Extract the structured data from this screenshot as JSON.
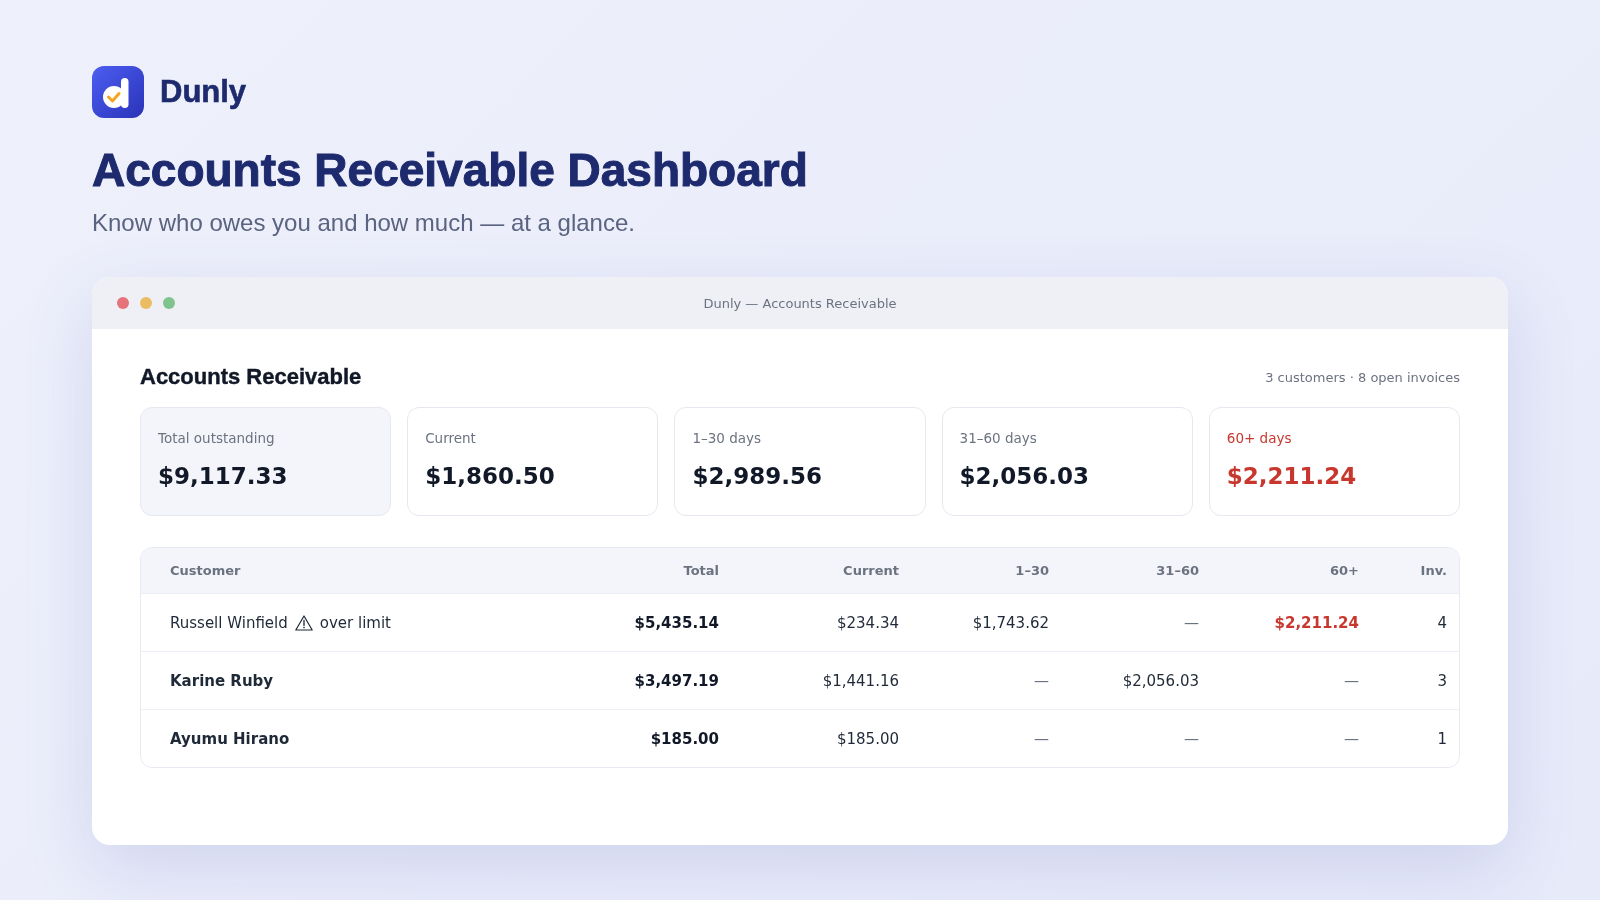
{
  "brand": {
    "name": "Dunly"
  },
  "hero": {
    "title": "Accounts Receivable Dashboard",
    "subtitle": "Know who owes you and how much — at a glance."
  },
  "window": {
    "title": "Dunly — Accounts Receivable"
  },
  "panel": {
    "heading": "Accounts Receivable",
    "summary": "3 customers · 8 open invoices",
    "cards": [
      {
        "kind": "total",
        "label": "Total outstanding",
        "value": "$9,117.33"
      },
      {
        "kind": "bucket",
        "label": "Current",
        "value": "$1,860.50"
      },
      {
        "kind": "bucket",
        "label": "1–30 days",
        "value": "$2,989.56"
      },
      {
        "kind": "bucket",
        "label": "31–60 days",
        "value": "$2,056.03"
      },
      {
        "kind": "overdue",
        "label": "60+ days",
        "value": "$2,211.24"
      }
    ],
    "table": {
      "columns": [
        "Customer",
        "Total",
        "Current",
        "1–30",
        "31–60",
        "60+",
        "Inv."
      ],
      "rows": [
        {
          "cells": [
            {
              "kind": "name",
              "text": "Russell Winfield",
              "flag": "over limit"
            },
            {
              "kind": "total",
              "text": "$5,435.14"
            },
            {
              "kind": "amount",
              "text": "$234.34"
            },
            {
              "kind": "amount",
              "text": "$1,743.62"
            },
            {
              "kind": "empty",
              "text": "—"
            },
            {
              "kind": "overdue",
              "text": "$2,211.24"
            },
            {
              "kind": "count",
              "text": "4"
            }
          ]
        },
        {
          "cells": [
            {
              "kind": "name",
              "text": "Karine Ruby"
            },
            {
              "kind": "total",
              "text": "$3,497.19"
            },
            {
              "kind": "amount",
              "text": "$1,441.16"
            },
            {
              "kind": "empty",
              "text": "—"
            },
            {
              "kind": "amount",
              "text": "$2,056.03"
            },
            {
              "kind": "empty",
              "text": "—"
            },
            {
              "kind": "count",
              "text": "3"
            }
          ]
        },
        {
          "cells": [
            {
              "kind": "name",
              "text": "Ayumu Hirano"
            },
            {
              "kind": "total",
              "text": "$185.00"
            },
            {
              "kind": "amount",
              "text": "$185.00"
            },
            {
              "kind": "empty",
              "text": "—"
            },
            {
              "kind": "empty",
              "text": "—"
            },
            {
              "kind": "empty",
              "text": "—"
            },
            {
              "kind": "count",
              "text": "1"
            }
          ]
        }
      ]
    }
  }
}
